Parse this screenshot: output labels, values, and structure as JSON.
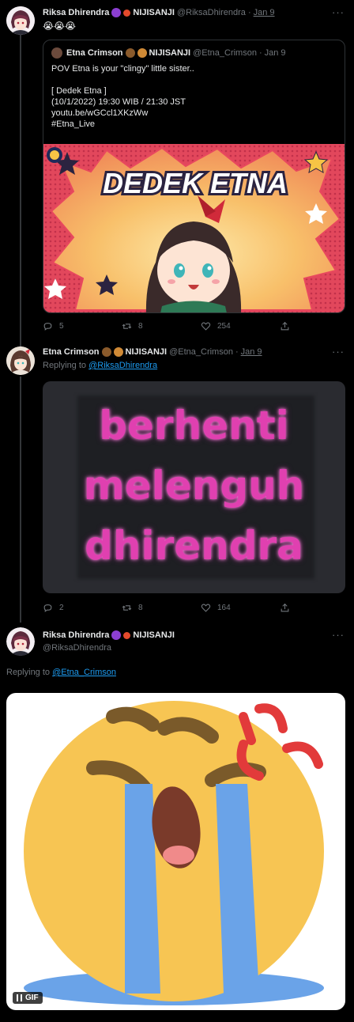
{
  "tweet1": {
    "name": "Riksa Dhirendra",
    "badge1": "😈",
    "badge2": "💥",
    "org": "NIJISANJI",
    "handle": "@RiksaDhirendra",
    "dot": "·",
    "date": "Jan 9",
    "text": "😭😭😭",
    "quote": {
      "name": "Etna Crimson",
      "badge1": "⛰",
      "badge2": "🍔",
      "org": "NIJISANJI",
      "handle": "@Etna_Crimson",
      "dot": "·",
      "date": "Jan 9",
      "text": "POV Etna is your \"clingy\" little sister..\n\n[ Dedek Etna ]\n(10/1/2022) 19:30 WIB / 21:30 JST\nyoutu.be/wGCcl1XKzWw\n#Etna_Live",
      "image_text": "DEDEK ETNA"
    },
    "actions": {
      "replies": "5",
      "retweets": "8",
      "likes": "254"
    }
  },
  "tweet2": {
    "name": "Etna Crimson",
    "badge1": "⛰",
    "badge2": "🍔",
    "org": "NIJISANJI",
    "handle": "@Etna_Crimson",
    "dot": "·",
    "date": "Jan 9",
    "replying_prefix": "Replying to",
    "replying_to": "@RiksaDhirendra",
    "image_lines": [
      "berhenti",
      "melenguh",
      "dhirendra"
    ],
    "actions": {
      "replies": "2",
      "retweets": "8",
      "likes": "164"
    }
  },
  "tweet3": {
    "name": "Riksa Dhirendra",
    "badge1": "😈",
    "badge2": "💥",
    "org": "NIJISANJI",
    "handle": "@RiksaDhirendra",
    "replying_prefix": "Replying to",
    "replying_to": "@Etna_Crimson",
    "gif_label": "GIF"
  },
  "colors": {
    "accent": "#1d9bf0",
    "muted": "#71767b",
    "border": "#2f3336",
    "pink": "#e040b0"
  }
}
